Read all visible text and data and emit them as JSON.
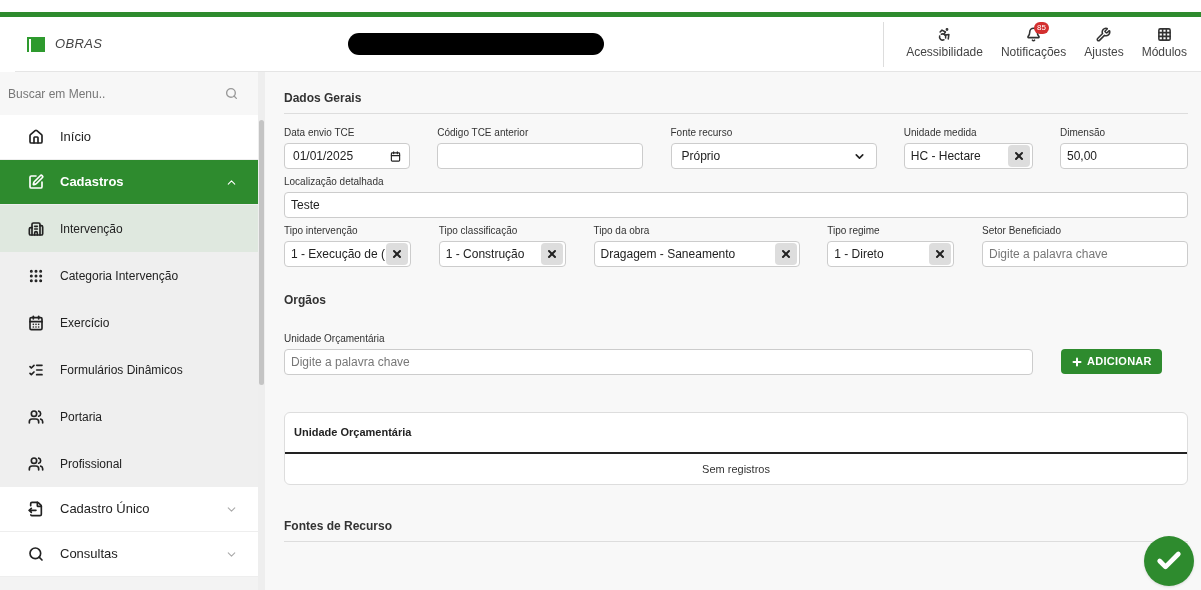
{
  "header": {
    "app_title": "OBRAS",
    "actions": [
      {
        "kind": "accessibility",
        "label": "Acessibilidade"
      },
      {
        "kind": "notifications",
        "label": "Notificações",
        "badge": "85"
      },
      {
        "kind": "settings",
        "label": "Ajustes"
      },
      {
        "kind": "modules",
        "label": "Módulos"
      }
    ]
  },
  "sidebar": {
    "search": {
      "placeholder": "Buscar em Menu.."
    },
    "items": [
      {
        "kind": "home",
        "label": "Início"
      },
      {
        "kind": "edit",
        "label": "Cadastros",
        "expanded": true,
        "children": [
          {
            "kind": "building",
            "label": "Intervenção",
            "selected": true
          },
          {
            "kind": "grid",
            "label": "Categoria Intervenção",
            "selected": false
          },
          {
            "kind": "calendar",
            "label": "Exercício",
            "selected": false
          },
          {
            "kind": "list",
            "label": "Formulários Dinâmicos",
            "selected": false
          },
          {
            "kind": "users",
            "label": "Portaria",
            "selected": false
          },
          {
            "kind": "users",
            "label": "Profissional",
            "selected": false
          }
        ]
      },
      {
        "kind": "export",
        "label": "Cadastro Único",
        "expanded": false
      },
      {
        "kind": "search",
        "label": "Consultas",
        "expanded": false
      }
    ]
  },
  "sections": [
    {
      "kind": "form",
      "title": "Dados Gerais",
      "rows": [
        [
          {
            "kind": "date",
            "label": "Data envio TCE",
            "value": "01/01/2025"
          },
          {
            "kind": "text",
            "label": "Código TCE anterior"
          },
          {
            "kind": "select",
            "label": "Fonte recurso",
            "value": "Próprio"
          },
          {
            "kind": "tag",
            "label": "Unidade medida",
            "value": "HC - Hectare"
          },
          {
            "kind": "text",
            "label": "Dimensão",
            "value": "50,00"
          }
        ],
        [
          {
            "kind": "text",
            "label": "Localização detalhada",
            "value": "Teste"
          }
        ],
        [
          {
            "kind": "tag",
            "label": "Tipo intervenção",
            "value": "1 - Execução de ("
          },
          {
            "kind": "tag",
            "label": "Tipo classificação",
            "value": "1 - Construção"
          },
          {
            "kind": "tag",
            "label": "Tipo da obra",
            "value": "Dragagem - Saneamento"
          },
          {
            "kind": "tag",
            "label": "Tipo regime",
            "value": "1 - Direto"
          },
          {
            "kind": "text",
            "label": "Setor Beneficiado",
            "placeholder": "Digite a palavra chave"
          }
        ]
      ]
    },
    {
      "kind": "orgaos",
      "title": "Orgãos",
      "field": {
        "label": "Unidade Orçamentária",
        "placeholder": "Digite a palavra chave"
      },
      "button": "ADICIONAR",
      "table": {
        "columns": [
          "Unidade Orçamentária"
        ],
        "empty": "Sem registros"
      }
    },
    {
      "kind": "heading",
      "title": "Fontes de Recurso"
    }
  ]
}
